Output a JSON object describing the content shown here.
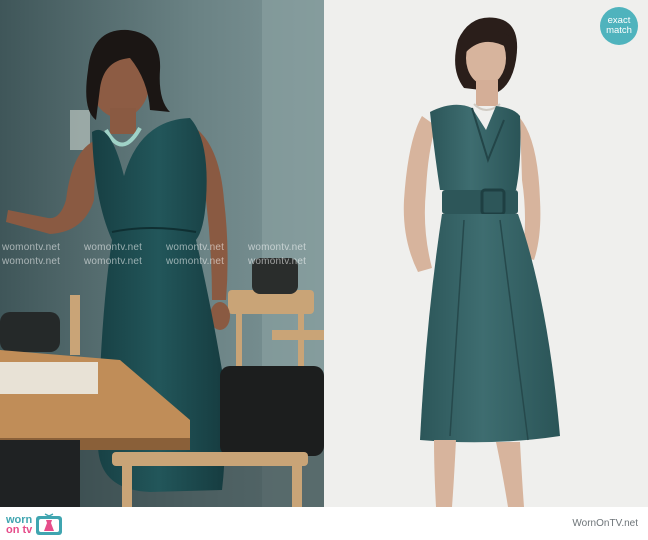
{
  "badge": {
    "line1": "exact",
    "line2": "match"
  },
  "watermark": {
    "text": "womontv.net"
  },
  "footer": {
    "logo_top": "worn",
    "logo_bottom": "on tv",
    "site": "WornOnTV.net"
  }
}
